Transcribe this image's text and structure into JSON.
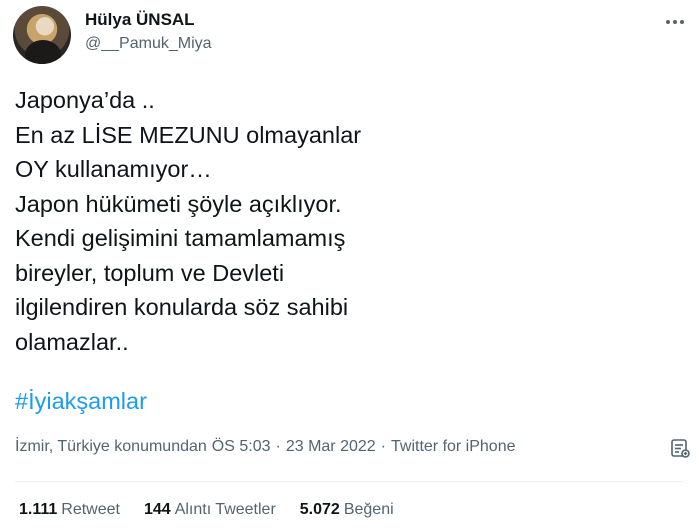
{
  "author": {
    "display_name": "Hülya ÜNSAL",
    "handle": "@__Pamuk_Miya"
  },
  "tweet": {
    "lines": [
      "Japonya’da ..",
      "En az LİSE MEZUNU olmayanlar",
      "OY kullanamıyor…",
      "Japon hükümeti şöyle açıklıyor.",
      "Kendi gelişimini tamamlamamış",
      "bireyler, toplum ve Devleti",
      "ilgilendiren konularda söz sahibi",
      "olamazlar.."
    ],
    "hashtag": "#İyiakşamlar"
  },
  "meta": {
    "location": "İzmir, Türkiye konumundan",
    "time": "ÖS 5:03",
    "date": "23 Mar 2022",
    "source": "Twitter for iPhone",
    "separator": "·"
  },
  "stats": {
    "retweets": {
      "value": "1.111",
      "label": "Retweet"
    },
    "quotes": {
      "value": "144",
      "label": "Alıntı Tweetler"
    },
    "likes": {
      "value": "5.072",
      "label": "Beğeni"
    }
  },
  "icons": {
    "more": "more-horizontal-icon",
    "analytics": "analytics-icon"
  },
  "colors": {
    "text": "#0f1419",
    "secondary": "#536471",
    "link": "#1d9bf0",
    "divider": "#eff3f4"
  }
}
